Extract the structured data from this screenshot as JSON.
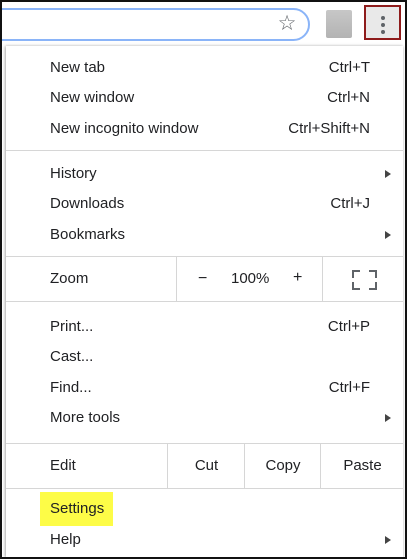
{
  "toolbar": {
    "star_icon": "star-icon",
    "menu_icon": "three-dot-menu-icon"
  },
  "menu": {
    "group1": [
      {
        "label": "New tab",
        "shortcut": "Ctrl+T"
      },
      {
        "label": "New window",
        "shortcut": "Ctrl+N"
      },
      {
        "label": "New incognito window",
        "shortcut": "Ctrl+Shift+N"
      }
    ],
    "group2": [
      {
        "label": "History",
        "shortcut": ""
      },
      {
        "label": "Downloads",
        "shortcut": "Ctrl+J"
      },
      {
        "label": "Bookmarks",
        "shortcut": ""
      }
    ],
    "zoom": {
      "label": "Zoom",
      "minus": "−",
      "value": "100%",
      "plus": "+"
    },
    "group3": [
      {
        "label": "Print...",
        "shortcut": "Ctrl+P"
      },
      {
        "label": "Cast...",
        "shortcut": ""
      },
      {
        "label": "Find...",
        "shortcut": "Ctrl+F"
      },
      {
        "label": "More tools",
        "shortcut": ""
      }
    ],
    "edit": {
      "label": "Edit",
      "cut": "Cut",
      "copy": "Copy",
      "paste": "Paste"
    },
    "group4": [
      {
        "label": "Settings",
        "highlight_color": "#fdfc47"
      },
      {
        "label": "Help"
      }
    ]
  }
}
